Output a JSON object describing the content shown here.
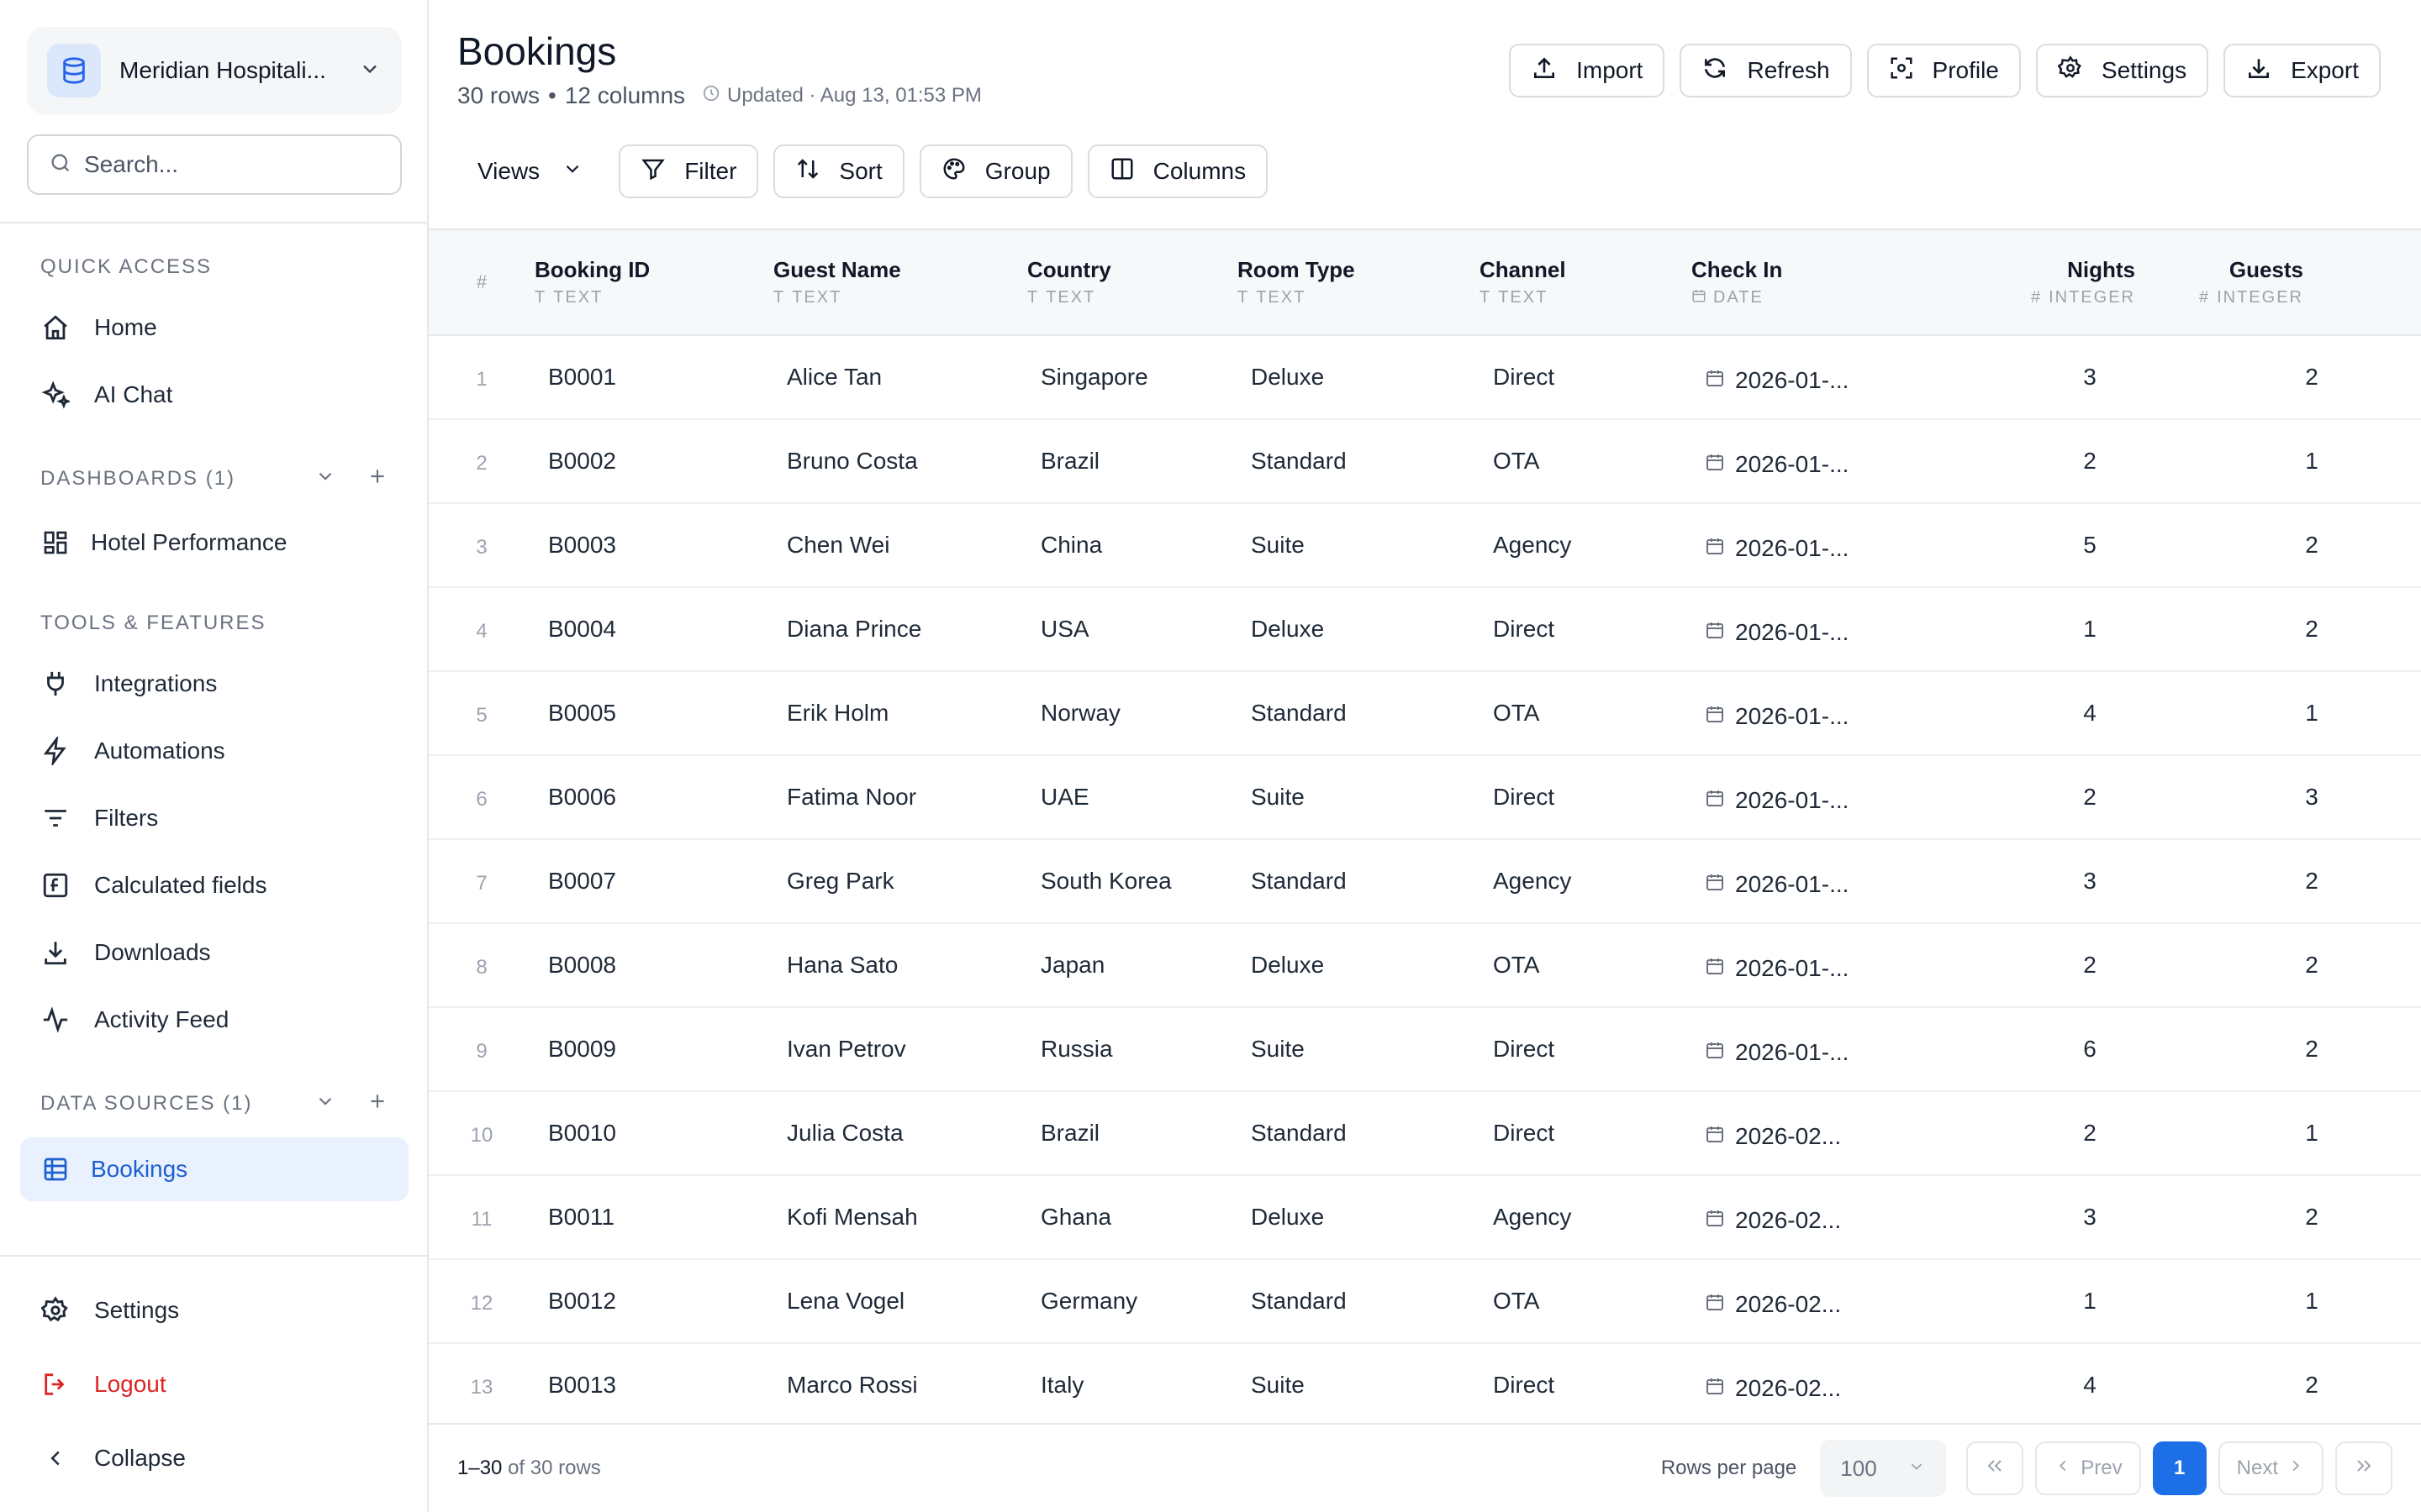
{
  "workspace": {
    "name": "Meridian Hospitali..."
  },
  "search": {
    "placeholder": "Search..."
  },
  "sidebar": {
    "quick_access_label": "QUICK ACCESS",
    "home": "Home",
    "ai_chat": "AI Chat",
    "dashboards_label": "DASHBOARDS (1)",
    "hotel_performance": "Hotel Performance",
    "tools_label": "TOOLS & FEATURES",
    "integrations": "Integrations",
    "automations": "Automations",
    "filters": "Filters",
    "calculated_fields": "Calculated fields",
    "downloads": "Downloads",
    "activity_feed": "Activity Feed",
    "datasources_label": "DATA SOURCES (1)",
    "bookings": "Bookings",
    "settings": "Settings",
    "logout": "Logout",
    "collapse": "Collapse"
  },
  "header": {
    "title": "Bookings",
    "rows": "30 rows",
    "columns": "12 columns",
    "separator": "•",
    "updated": "Updated · Aug 13, 01:53 PM"
  },
  "actions": {
    "import": "Import",
    "refresh": "Refresh",
    "profile": "Profile",
    "settings": "Settings",
    "export": "Export"
  },
  "toolbar": {
    "views": "Views",
    "filter": "Filter",
    "sort": "Sort",
    "group": "Group",
    "columns": "Columns"
  },
  "table": {
    "index_header": "#",
    "columns": [
      {
        "name": "Booking ID",
        "type": "TEXT"
      },
      {
        "name": "Guest Name",
        "type": "TEXT"
      },
      {
        "name": "Country",
        "type": "TEXT"
      },
      {
        "name": "Room Type",
        "type": "TEXT"
      },
      {
        "name": "Channel",
        "type": "TEXT"
      },
      {
        "name": "Check In",
        "type": "DATE"
      },
      {
        "name": "Nights",
        "type": "INTEGER"
      },
      {
        "name": "Guests",
        "type": "INTEGER"
      }
    ],
    "rows": [
      {
        "idx": "1",
        "id": "B0001",
        "guest": "Alice Tan",
        "country": "Singapore",
        "room": "Deluxe",
        "channel": "Direct",
        "checkin": "2026-01-...",
        "nights": "3",
        "guests": "2"
      },
      {
        "idx": "2",
        "id": "B0002",
        "guest": "Bruno Costa",
        "country": "Brazil",
        "room": "Standard",
        "channel": "OTA",
        "checkin": "2026-01-...",
        "nights": "2",
        "guests": "1"
      },
      {
        "idx": "3",
        "id": "B0003",
        "guest": "Chen Wei",
        "country": "China",
        "room": "Suite",
        "channel": "Agency",
        "checkin": "2026-01-...",
        "nights": "5",
        "guests": "2"
      },
      {
        "idx": "4",
        "id": "B0004",
        "guest": "Diana Prince",
        "country": "USA",
        "room": "Deluxe",
        "channel": "Direct",
        "checkin": "2026-01-...",
        "nights": "1",
        "guests": "2"
      },
      {
        "idx": "5",
        "id": "B0005",
        "guest": "Erik Holm",
        "country": "Norway",
        "room": "Standard",
        "channel": "OTA",
        "checkin": "2026-01-...",
        "nights": "4",
        "guests": "1"
      },
      {
        "idx": "6",
        "id": "B0006",
        "guest": "Fatima Noor",
        "country": "UAE",
        "room": "Suite",
        "channel": "Direct",
        "checkin": "2026-01-...",
        "nights": "2",
        "guests": "3"
      },
      {
        "idx": "7",
        "id": "B0007",
        "guest": "Greg Park",
        "country": "South Korea",
        "room": "Standard",
        "channel": "Agency",
        "checkin": "2026-01-...",
        "nights": "3",
        "guests": "2"
      },
      {
        "idx": "8",
        "id": "B0008",
        "guest": "Hana Sato",
        "country": "Japan",
        "room": "Deluxe",
        "channel": "OTA",
        "checkin": "2026-01-...",
        "nights": "2",
        "guests": "2"
      },
      {
        "idx": "9",
        "id": "B0009",
        "guest": "Ivan Petrov",
        "country": "Russia",
        "room": "Suite",
        "channel": "Direct",
        "checkin": "2026-01-...",
        "nights": "6",
        "guests": "2"
      },
      {
        "idx": "10",
        "id": "B0010",
        "guest": "Julia Costa",
        "country": "Brazil",
        "room": "Standard",
        "channel": "Direct",
        "checkin": "2026-02...",
        "nights": "2",
        "guests": "1"
      },
      {
        "idx": "11",
        "id": "B0011",
        "guest": "Kofi Mensah",
        "country": "Ghana",
        "room": "Deluxe",
        "channel": "Agency",
        "checkin": "2026-02...",
        "nights": "3",
        "guests": "2"
      },
      {
        "idx": "12",
        "id": "B0012",
        "guest": "Lena Vogel",
        "country": "Germany",
        "room": "Standard",
        "channel": "OTA",
        "checkin": "2026-02...",
        "nights": "1",
        "guests": "1"
      },
      {
        "idx": "13",
        "id": "B0013",
        "guest": "Marco Rossi",
        "country": "Italy",
        "room": "Suite",
        "channel": "Direct",
        "checkin": "2026-02...",
        "nights": "4",
        "guests": "2"
      }
    ]
  },
  "footer": {
    "range": "1–30",
    "of_rows": "of 30 rows",
    "rows_per_page_label": "Rows per page",
    "rows_per_page": "100",
    "prev": "Prev",
    "next": "Next",
    "current_page": "1"
  },
  "colors": {
    "accent": "#1d6fe8",
    "active_bg": "#e8f1fd",
    "danger": "#dc2626",
    "border": "#e5e7eb"
  }
}
